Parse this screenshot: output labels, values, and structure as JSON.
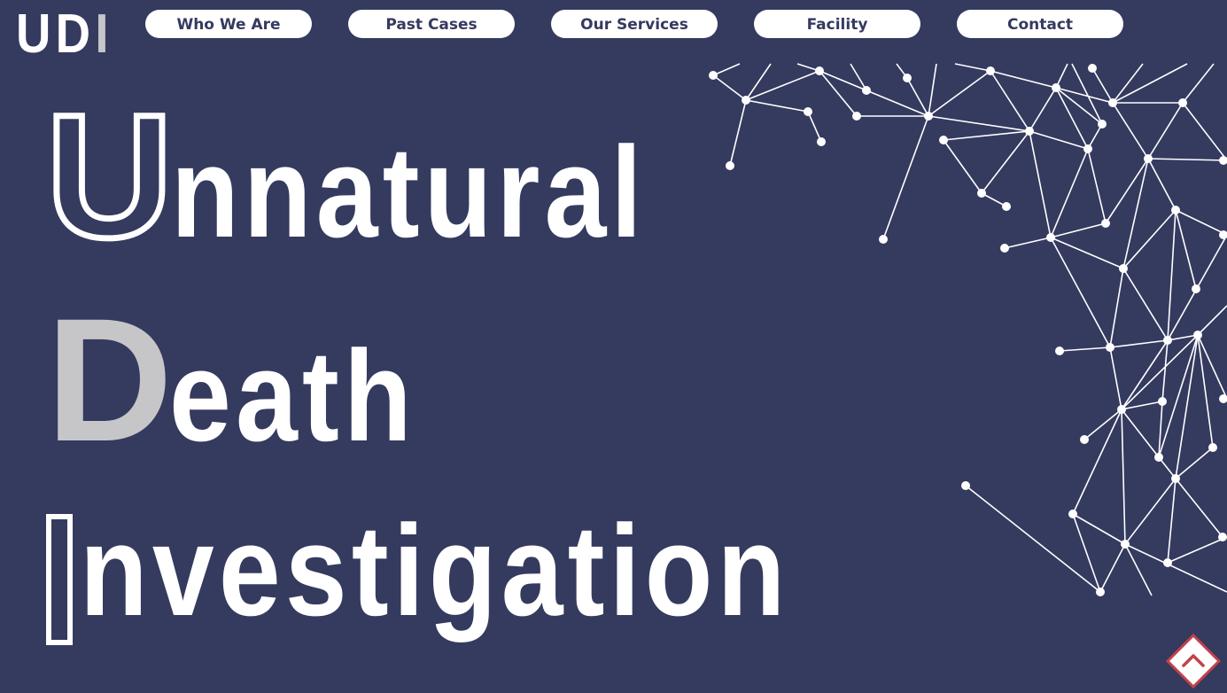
{
  "logo": {
    "part1": "UD",
    "part2": "I"
  },
  "nav": {
    "items": [
      {
        "label": "Who We Are"
      },
      {
        "label": "Past Cases"
      },
      {
        "label": "Our Services"
      },
      {
        "label": "Facility"
      },
      {
        "label": "Contact"
      }
    ]
  },
  "hero": {
    "lines": [
      {
        "initial": "U",
        "rest": "nnatural"
      },
      {
        "initial": "D",
        "rest": "eath"
      },
      {
        "initial": "I",
        "rest": "nvestigation"
      }
    ]
  },
  "icons": {
    "network": "network-graph-icon",
    "scroll_top": "chevron-up-icon"
  },
  "colors": {
    "background": "#353a5f",
    "accent_grey": "#c6c6c8",
    "scroll_top_border": "#c0424c"
  }
}
